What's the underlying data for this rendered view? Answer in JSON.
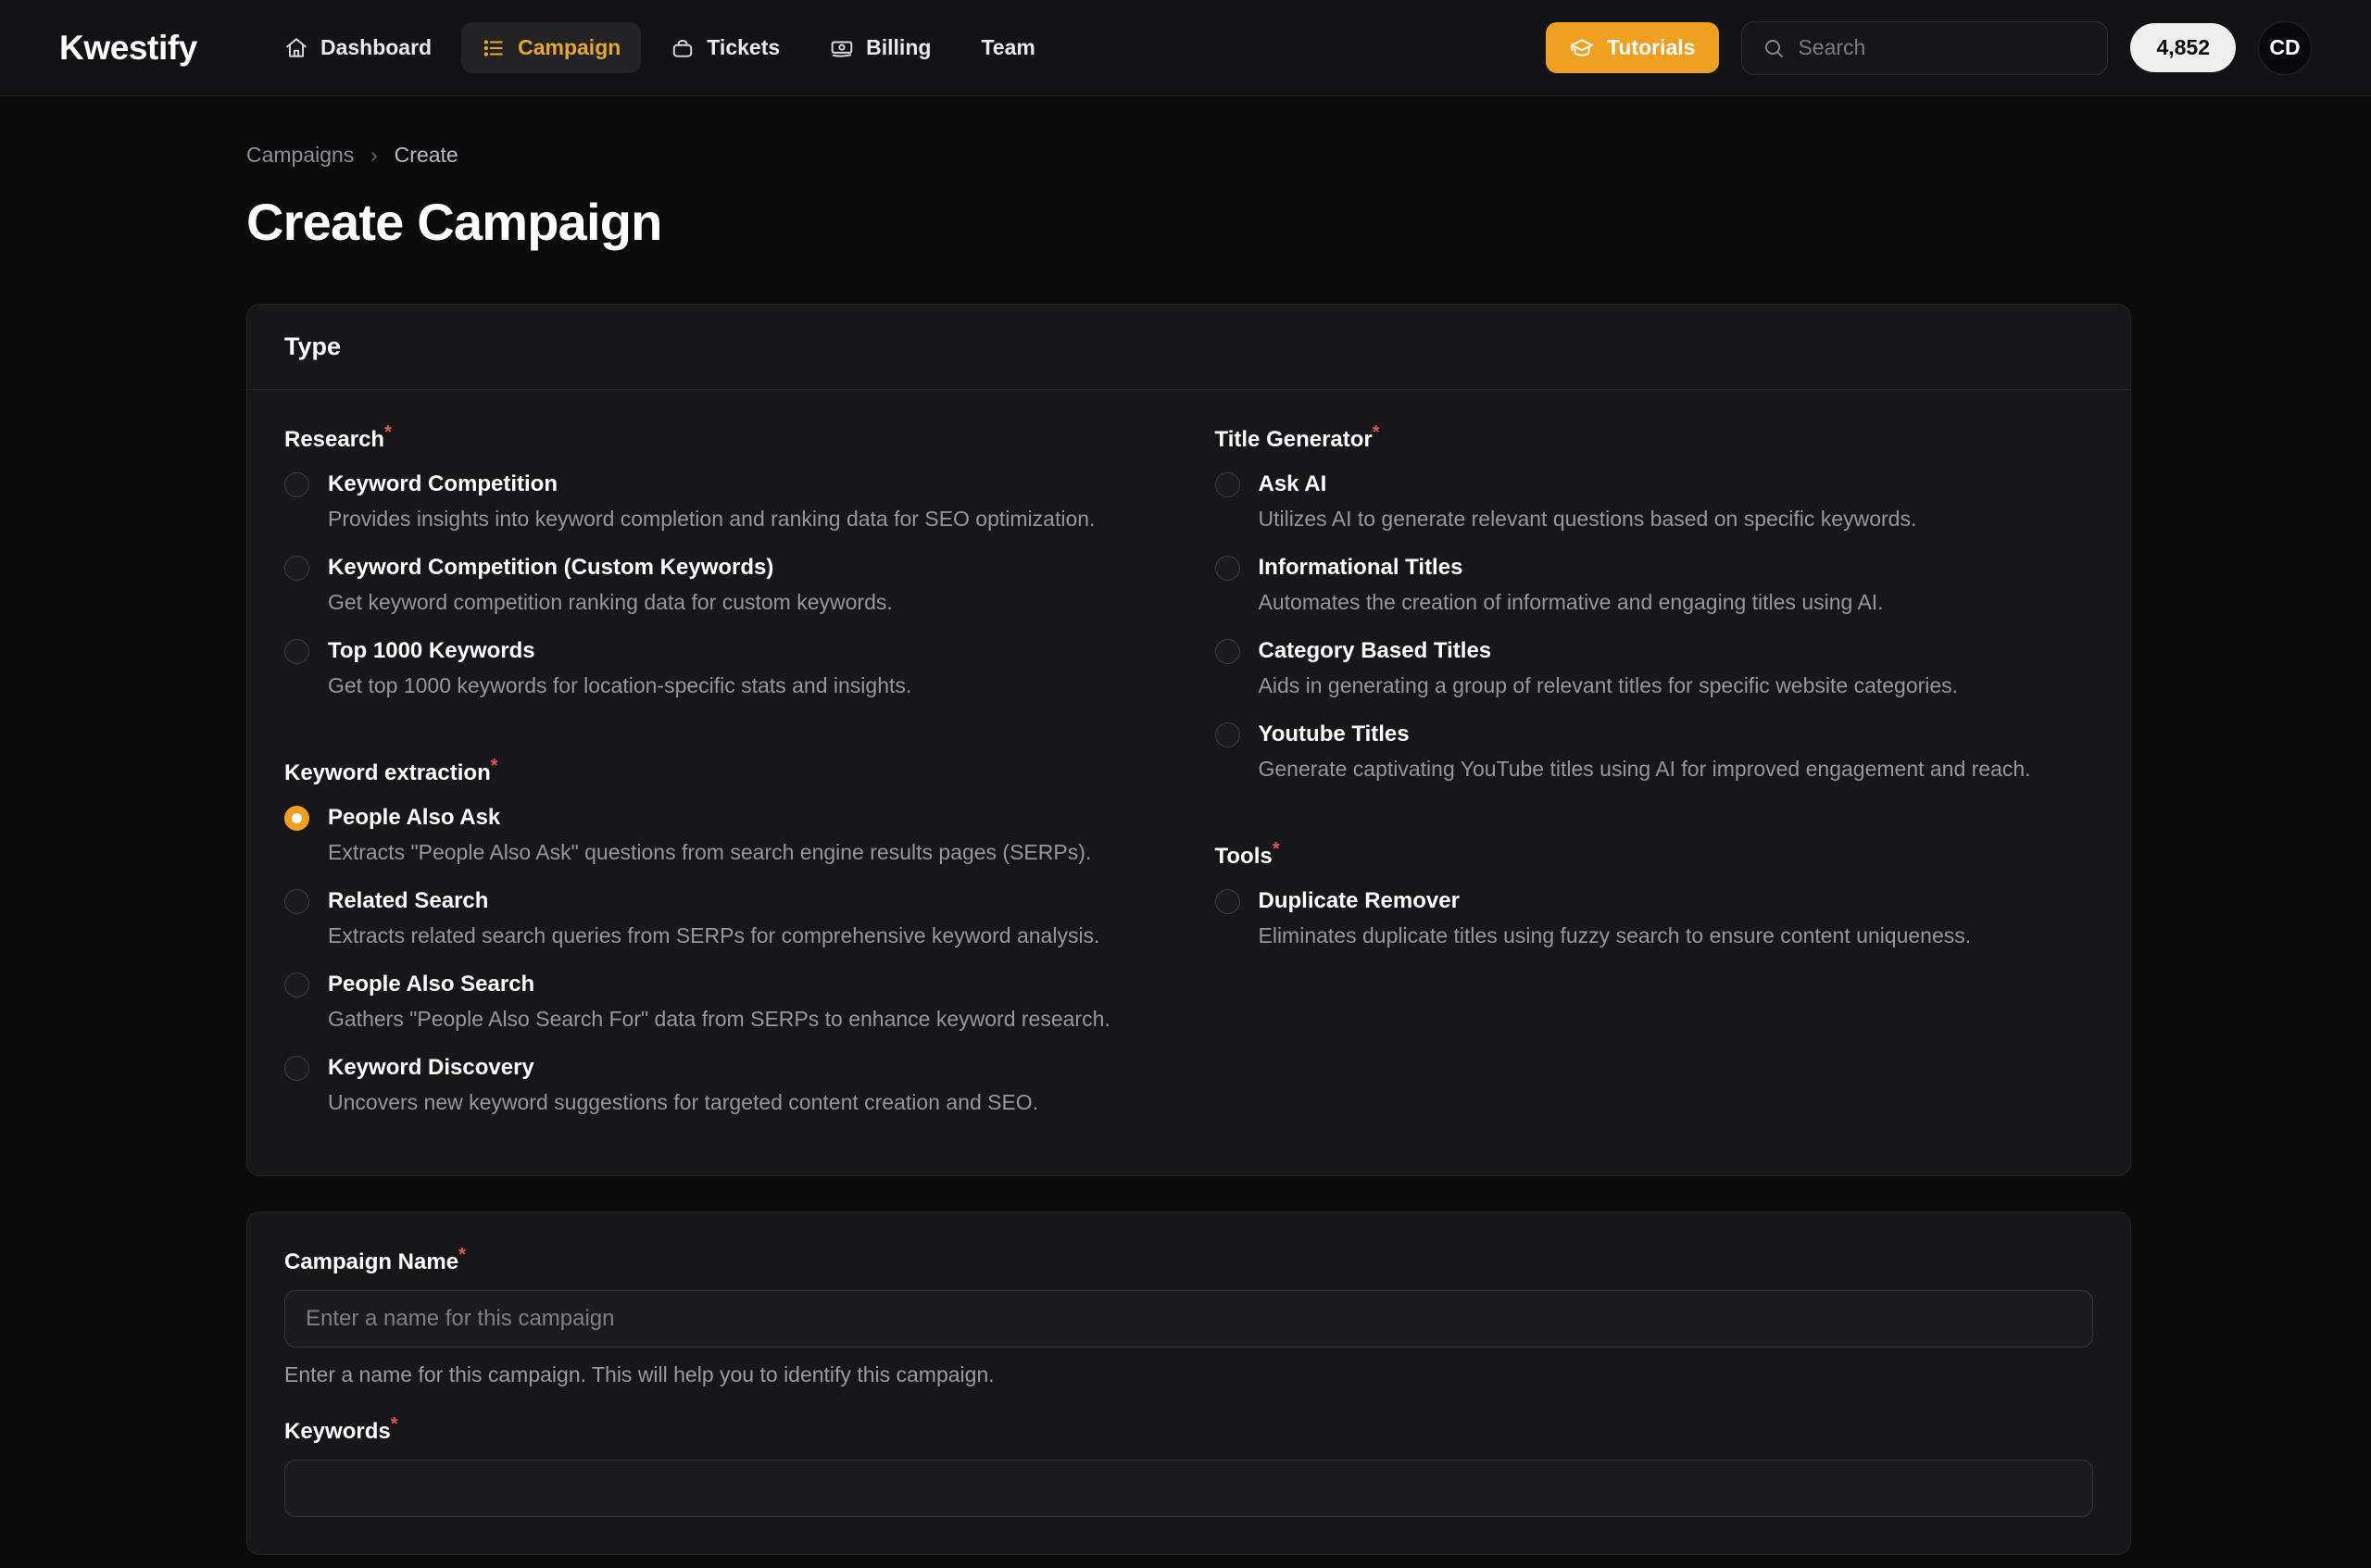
{
  "header": {
    "brand": "Kwestify",
    "nav": [
      {
        "label": "Dashboard",
        "icon": "home-icon",
        "active": false
      },
      {
        "label": "Campaign",
        "icon": "list-icon",
        "active": true
      },
      {
        "label": "Tickets",
        "icon": "bag-icon",
        "active": false
      },
      {
        "label": "Billing",
        "icon": "banknote-icon",
        "active": false
      },
      {
        "label": "Team",
        "icon": "",
        "active": false
      }
    ],
    "tutorials_label": "Tutorials",
    "tutorials_icon": "graduation-cap-icon",
    "search_placeholder": "Search",
    "search_value": "",
    "search_icon": "search-icon",
    "credits": "4,852",
    "avatar_initials": "CD",
    "accent_color": "#f0a020",
    "active_nav_color": "#e8a82c"
  },
  "breadcrumb": {
    "parent": "Campaigns",
    "separator": "›",
    "current": "Create"
  },
  "page_title": "Create Campaign",
  "type_card": {
    "heading": "Type",
    "required_mark": "*",
    "left_groups": [
      {
        "label": "Research",
        "required": true,
        "options": [
          {
            "title": "Keyword Competition",
            "desc": "Provides insights into keyword completion and ranking data for SEO optimization.",
            "selected": false
          },
          {
            "title": "Keyword Competition (Custom Keywords)",
            "desc": "Get keyword competition ranking data for custom keywords.",
            "selected": false
          },
          {
            "title": "Top 1000 Keywords",
            "desc": "Get top 1000 keywords for location-specific stats and insights.",
            "selected": false
          }
        ]
      },
      {
        "label": "Keyword extraction",
        "required": true,
        "options": [
          {
            "title": "People Also Ask",
            "desc": "Extracts \"People Also Ask\" questions from search engine results pages (SERPs).",
            "selected": true
          },
          {
            "title": "Related Search",
            "desc": "Extracts related search queries from SERPs for comprehensive keyword analysis.",
            "selected": false
          },
          {
            "title": "People Also Search",
            "desc": "Gathers \"People Also Search For\" data from SERPs to enhance keyword research.",
            "selected": false
          },
          {
            "title": "Keyword Discovery",
            "desc": "Uncovers new keyword suggestions for targeted content creation and SEO.",
            "selected": false
          }
        ]
      }
    ],
    "right_groups": [
      {
        "label": "Title Generator",
        "required": true,
        "options": [
          {
            "title": "Ask AI",
            "desc": "Utilizes AI to generate relevant questions based on specific keywords.",
            "selected": false
          },
          {
            "title": "Informational Titles",
            "desc": "Automates the creation of informative and engaging titles using AI.",
            "selected": false
          },
          {
            "title": "Category Based Titles",
            "desc": "Aids in generating a group of relevant titles for specific website categories.",
            "selected": false
          },
          {
            "title": "Youtube Titles",
            "desc": "Generate captivating YouTube titles using AI for improved engagement and reach.",
            "selected": false
          }
        ]
      },
      {
        "label": "Tools",
        "required": true,
        "options": [
          {
            "title": "Duplicate Remover",
            "desc": "Eliminates duplicate titles using fuzzy search to ensure content uniqueness.",
            "selected": false
          }
        ]
      }
    ]
  },
  "details_card": {
    "fields": [
      {
        "label": "Campaign Name",
        "required": true,
        "placeholder": "Enter a name for this campaign",
        "value": "",
        "help": "Enter a name for this campaign. This will help you to identify this campaign."
      },
      {
        "label": "Keywords",
        "required": true,
        "placeholder": "",
        "value": "",
        "help": ""
      }
    ]
  }
}
